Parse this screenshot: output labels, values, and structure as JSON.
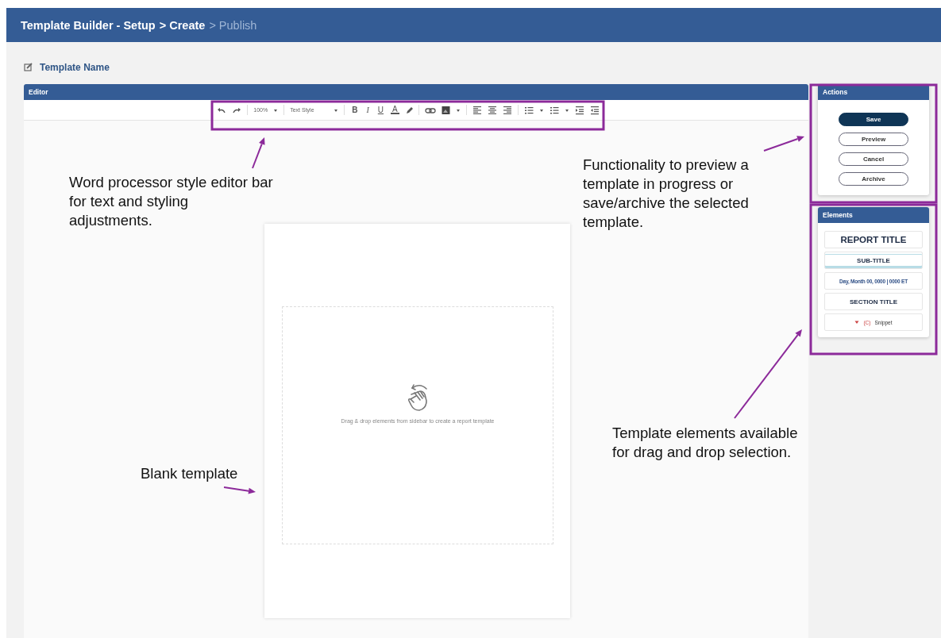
{
  "header": {
    "steps": [
      {
        "label": "Template Builder - Setup",
        "reached": true
      },
      {
        "label": "> Create",
        "reached": true
      },
      {
        "label": "> Publish",
        "reached": false
      }
    ]
  },
  "template_name": "Template Name",
  "editor": {
    "title": "Editor",
    "toolbar": {
      "zoom": "100%",
      "text_style": "Text Style",
      "format_buttons": [
        "B",
        "I",
        "U",
        "A"
      ]
    },
    "drop_hint": "Drag & drop elements from sidebar to create a report template"
  },
  "actions": {
    "title": "Actions",
    "buttons": [
      {
        "label": "Save",
        "primary": true
      },
      {
        "label": "Preview",
        "primary": false
      },
      {
        "label": "Cancel",
        "primary": false
      },
      {
        "label": "Archive",
        "primary": false
      }
    ]
  },
  "elements": {
    "title": "Elements",
    "items": [
      {
        "kind": "report-title",
        "label": "REPORT TITLE"
      },
      {
        "kind": "sub-title",
        "label": "SUB-TITLE"
      },
      {
        "kind": "date",
        "label": "Day, Month 00, 0000  |  0000 ET"
      },
      {
        "kind": "section-title",
        "label": "SECTION TITLE"
      },
      {
        "kind": "snippet",
        "marker": "(C)",
        "label": "Snippet"
      }
    ]
  },
  "annotations": [
    {
      "text": "Word processor style editor bar for text and styling adjustments."
    },
    {
      "text": "Functionality to preview a template in progress or save/archive the selected template."
    },
    {
      "text": "Template elements available for drag and drop selection."
    },
    {
      "text": "Blank template"
    }
  ]
}
